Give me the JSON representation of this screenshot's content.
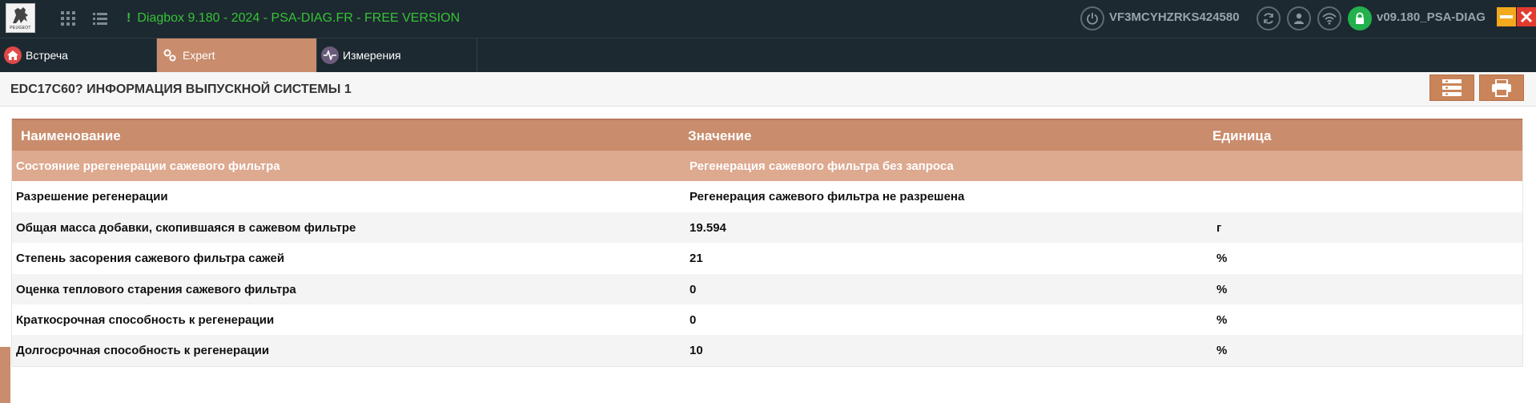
{
  "app": {
    "title": "Diagbox 9.180 - 2024 - PSA-DIAG.FR - FREE VERSION",
    "alert_glyph": "!",
    "logo_text": "PEUGEOT",
    "vin": "VF3MCYHZRKS424580",
    "version": "v09.180_PSA-DIAG",
    "icons": [
      "apps-grid-icon",
      "list-icon",
      "power-icon",
      "refresh-icon",
      "user-icon",
      "wifi-icon",
      "lock-icon",
      "minimize-icon",
      "close-icon"
    ]
  },
  "tabs": [
    {
      "label": "Встреча",
      "icon": "home-icon"
    },
    {
      "label": "Expert",
      "icon": "gears-icon"
    },
    {
      "label": "Измерения",
      "icon": "pulse-icon"
    }
  ],
  "page": {
    "title": "EDC17C60? ИНФОРМАЦИЯ ВЫПУСКНОЙ СИСТЕМЫ 1"
  },
  "table": {
    "headers": [
      "Наименование",
      "Значение",
      "Единица"
    ],
    "rows": [
      {
        "name": "Состояние ррегенерации сажевого фильтра",
        "value": "Регенерация сажевого фильтра без запроса",
        "unit": ""
      },
      {
        "name": "Разрешение регенерации",
        "value": "Регенерация сажевого фильтра не разрешена",
        "unit": ""
      },
      {
        "name": "Общая масса добавки, скопившаяся в сажевом фильтре",
        "value": "19.594",
        "unit": "г"
      },
      {
        "name": "Степень засорения сажевого фильтра сажей",
        "value": "21",
        "unit": "%"
      },
      {
        "name": "Оценка теплового старения сажевого фильтра",
        "value": "0",
        "unit": "%"
      },
      {
        "name": "Краткосрочная способность к регенерации",
        "value": "0",
        "unit": "%"
      },
      {
        "name": "Долгосрочная способность к регенерации",
        "value": "10",
        "unit": "%"
      }
    ]
  },
  "colors": {
    "accent": "#c98c6c",
    "selected_row": "#dda98f",
    "topbar": "#1d2931",
    "title_green": "#35c335"
  }
}
